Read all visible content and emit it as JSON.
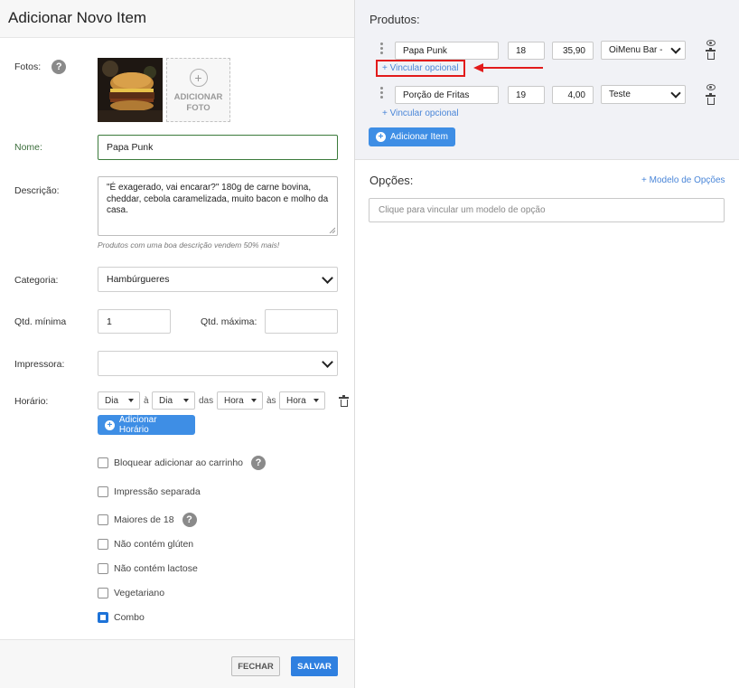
{
  "form": {
    "title": "Adicionar Novo Item",
    "photos_label": "Fotos:",
    "help_glyph": "?",
    "add_photo_label": "ADICIONAR FOTO",
    "add_photo_plus": "+",
    "name_label": "Nome:",
    "name_value": "Papa Punk",
    "description_label": "Descrição:",
    "description_value": "\"É exagerado, vai encarar?\" 180g de carne bovina, cheddar, cebola caramelizada, muito bacon e molho da casa.",
    "description_hint": "Produtos com uma boa descrição vendem 50% mais!",
    "category_label": "Categoria:",
    "category_value": "Hambúrgueres",
    "qty_min_label": "Qtd. mínima",
    "qty_min_value": "1",
    "qty_max_label": "Qtd. máxima:",
    "qty_max_value": "",
    "printer_label": "Impressora:",
    "printer_value": "",
    "schedule_label": "Horário:",
    "schedule": {
      "day_from": "Dia",
      "sep_a": "à",
      "day_to": "Dia",
      "sep_das": "das",
      "hour_from": "Hora",
      "sep_as": "às",
      "hour_to": "Hora"
    },
    "add_schedule_label": "Adicionar Horário",
    "checkboxes": [
      {
        "label": "Bloquear adicionar ao carrinho",
        "checked": false,
        "help": true
      },
      {
        "label": "Impressão separada",
        "checked": false,
        "help": false
      },
      {
        "label": "Maiores de 18",
        "checked": false,
        "help": true
      },
      {
        "label": "Não contém glúten",
        "checked": false,
        "help": false
      },
      {
        "label": "Não contém lactose",
        "checked": false,
        "help": false
      },
      {
        "label": "Vegetariano",
        "checked": false,
        "help": false
      },
      {
        "label": "Combo",
        "checked": true,
        "help": false
      }
    ],
    "close_label": "FECHAR",
    "save_label": "SALVAR"
  },
  "products": {
    "title": "Produtos:",
    "items": [
      {
        "name": "Papa Punk",
        "qty": "18",
        "price": "35,90",
        "option": "OiMenu Bar -",
        "link": "+ Vincular opcional"
      },
      {
        "name": "Porção de Fritas",
        "qty": "19",
        "price": "4,00",
        "option": "Teste",
        "link": "+ Vincular opcional"
      }
    ],
    "add_item_label": "Adicionar Item"
  },
  "options": {
    "title": "Opções:",
    "model_link": "+ Modelo de Opções",
    "placeholder": "Clique para vincular um modelo de opção"
  },
  "colors": {
    "accent": "#3e8ee5",
    "annotation": "#e21b1b"
  }
}
